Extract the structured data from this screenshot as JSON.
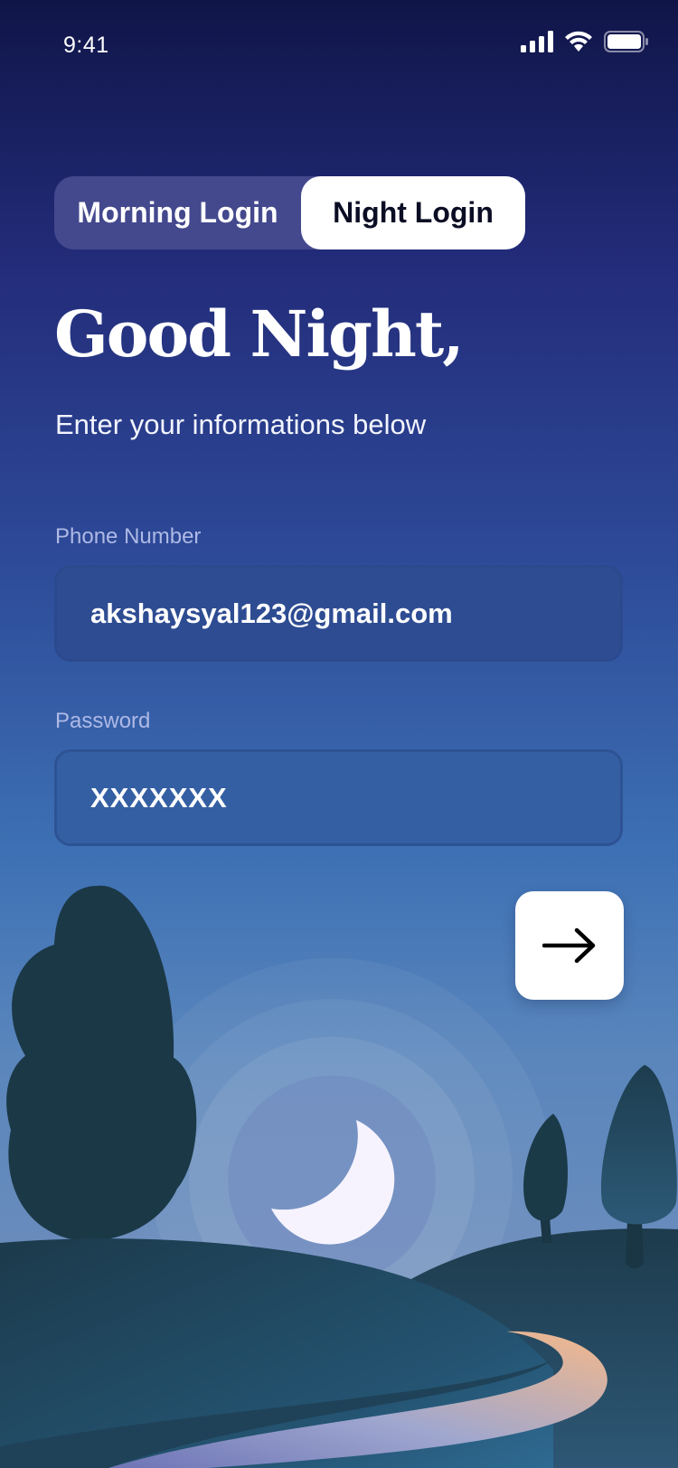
{
  "status_bar": {
    "time": "9:41"
  },
  "login_tabs": [
    {
      "label": "Morning Login",
      "selected": false
    },
    {
      "label": "Night Login",
      "selected": true
    }
  ],
  "header": {
    "title": "Good Night,",
    "subtitle": "Enter your informations below"
  },
  "form": {
    "phone": {
      "label": "Phone Number",
      "value": "akshaysyal123@gmail.com"
    },
    "password": {
      "label": "Password",
      "value": "XXXXXXX"
    }
  },
  "submit_button": {
    "icon": "arrow-right-icon"
  },
  "colors": {
    "background_top": "#101548",
    "background_bottom": "#6f8cba",
    "tab_track": "#44498e",
    "tab_selected": "#ffffff",
    "input_fill": "#2e4c92",
    "moon": "#f6f3ff",
    "hills": "#1c3b4d",
    "path": "#f3b58a"
  }
}
